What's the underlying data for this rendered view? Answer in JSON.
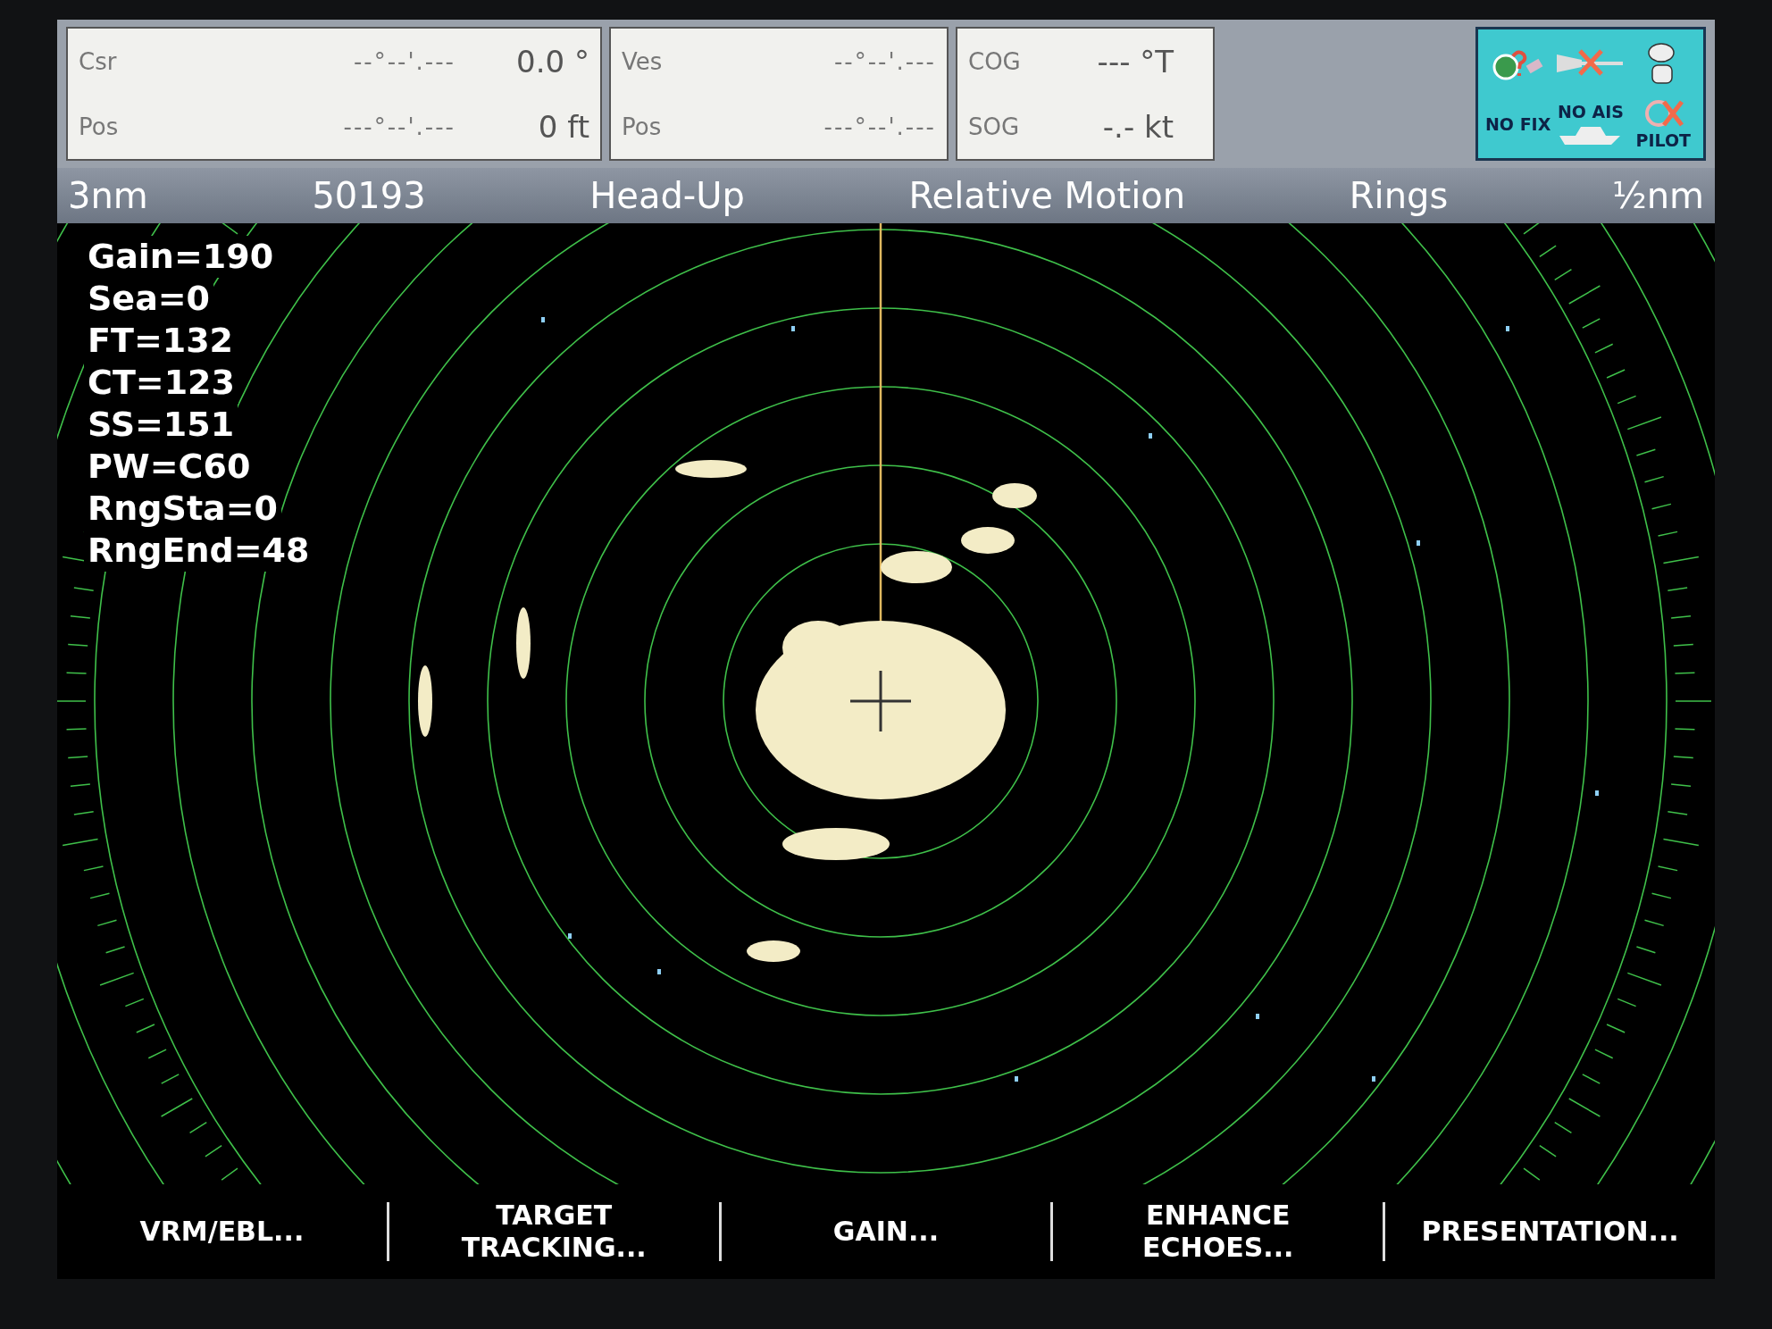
{
  "readout_panels": [
    {
      "rows": [
        {
          "label": "Csr",
          "position": "--°--'.---",
          "value": "0.0 °"
        },
        {
          "label": "Pos",
          "position": "---°--'.---",
          "value": "0 ft"
        }
      ]
    },
    {
      "rows": [
        {
          "label": "Ves",
          "position": "--°--'.---"
        },
        {
          "label": "Pos",
          "position": "---°--'.---"
        }
      ]
    },
    {
      "rows": [
        {
          "label": "COG",
          "value": "--- °T"
        },
        {
          "label": "SOG",
          "value": "-.- kt"
        }
      ]
    }
  ],
  "status_box": {
    "fix": "NO FIX",
    "ais": "NO AIS",
    "pilot": "PILOT"
  },
  "status_bar": [
    "3nm",
    "50193",
    "Head-Up",
    "Relative Motion",
    "Rings",
    "½nm"
  ],
  "radar_parameters": [
    "Gain=190",
    "Sea=0",
    "FT=132",
    "CT=123",
    "SS=151",
    "PW=C60",
    "RngSta=0",
    "RngEnd=48"
  ],
  "softkeys": [
    {
      "lines": [
        "VRM/EBL..."
      ]
    },
    {
      "lines": [
        "TARGET",
        "TRACKING..."
      ]
    },
    {
      "lines": [
        "GAIN..."
      ]
    },
    {
      "lines": [
        "ENHANCE",
        "ECHOES..."
      ]
    },
    {
      "lines": [
        "PRESENTATION..."
      ]
    }
  ]
}
